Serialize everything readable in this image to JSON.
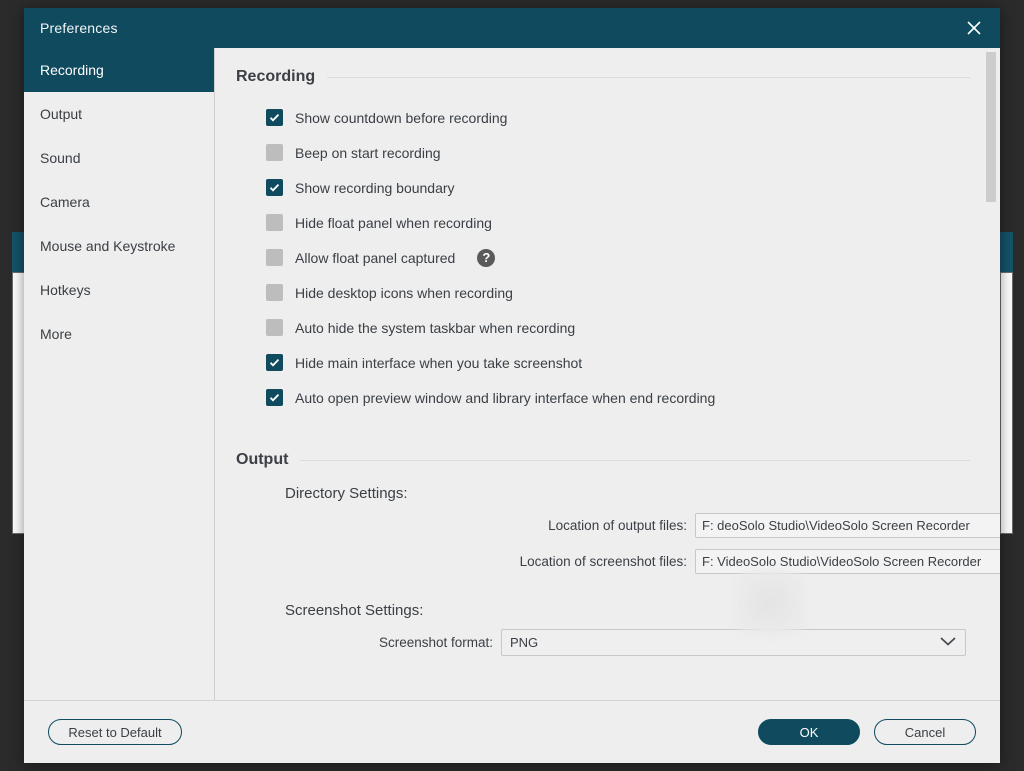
{
  "window": {
    "title": "Preferences",
    "close_icon": "close-icon",
    "accent_color": "#0f4a5e",
    "background_color": "#eeeeee"
  },
  "sidebar": {
    "items": [
      {
        "label": "Recording",
        "active": true
      },
      {
        "label": "Output",
        "active": false
      },
      {
        "label": "Sound",
        "active": false
      },
      {
        "label": "Camera",
        "active": false
      },
      {
        "label": "Mouse and Keystroke",
        "active": false
      },
      {
        "label": "Hotkeys",
        "active": false
      },
      {
        "label": "More",
        "active": false
      }
    ]
  },
  "recording_section": {
    "heading": "Recording",
    "checkboxes": [
      {
        "label": "Show countdown before recording",
        "checked": true,
        "help": false
      },
      {
        "label": "Beep on start recording",
        "checked": false,
        "help": false
      },
      {
        "label": "Show recording boundary",
        "checked": true,
        "help": false
      },
      {
        "label": "Hide float panel when recording",
        "checked": false,
        "help": false
      },
      {
        "label": "Allow float panel captured",
        "checked": false,
        "help": true,
        "help_icon": "help-circle-icon",
        "help_glyph": "?"
      },
      {
        "label": "Hide desktop icons when recording",
        "checked": false,
        "help": false
      },
      {
        "label": "Auto hide the system taskbar when recording",
        "checked": false,
        "help": false
      },
      {
        "label": "Hide main interface when you take screenshot",
        "checked": true,
        "help": false
      },
      {
        "label": "Auto open preview window and library interface when end recording",
        "checked": true,
        "help": false
      }
    ]
  },
  "output_section": {
    "heading": "Output",
    "directory_settings_label": "Directory Settings:",
    "output_files": {
      "label": "Location of output files:",
      "value": "F:                     deoSolo Studio\\VideoSolo Screen Recorder",
      "browse_label": "•••",
      "browse_icon": "ellipsis-icon",
      "folder_icon": "folder-icon"
    },
    "screenshot_files": {
      "label": "Location of screenshot files:",
      "value": "F:                  VideoSolo Studio\\VideoSolo Screen Recorder",
      "browse_label": "•••",
      "browse_icon": "ellipsis-icon",
      "folder_icon": "folder-icon"
    },
    "screenshot_settings_label": "Screenshot Settings:",
    "screenshot_format": {
      "label": "Screenshot format:",
      "value": "PNG",
      "chevron_icon": "chevron-down-icon"
    }
  },
  "footer": {
    "reset_label": "Reset to Default",
    "ok_label": "OK",
    "cancel_label": "Cancel"
  }
}
